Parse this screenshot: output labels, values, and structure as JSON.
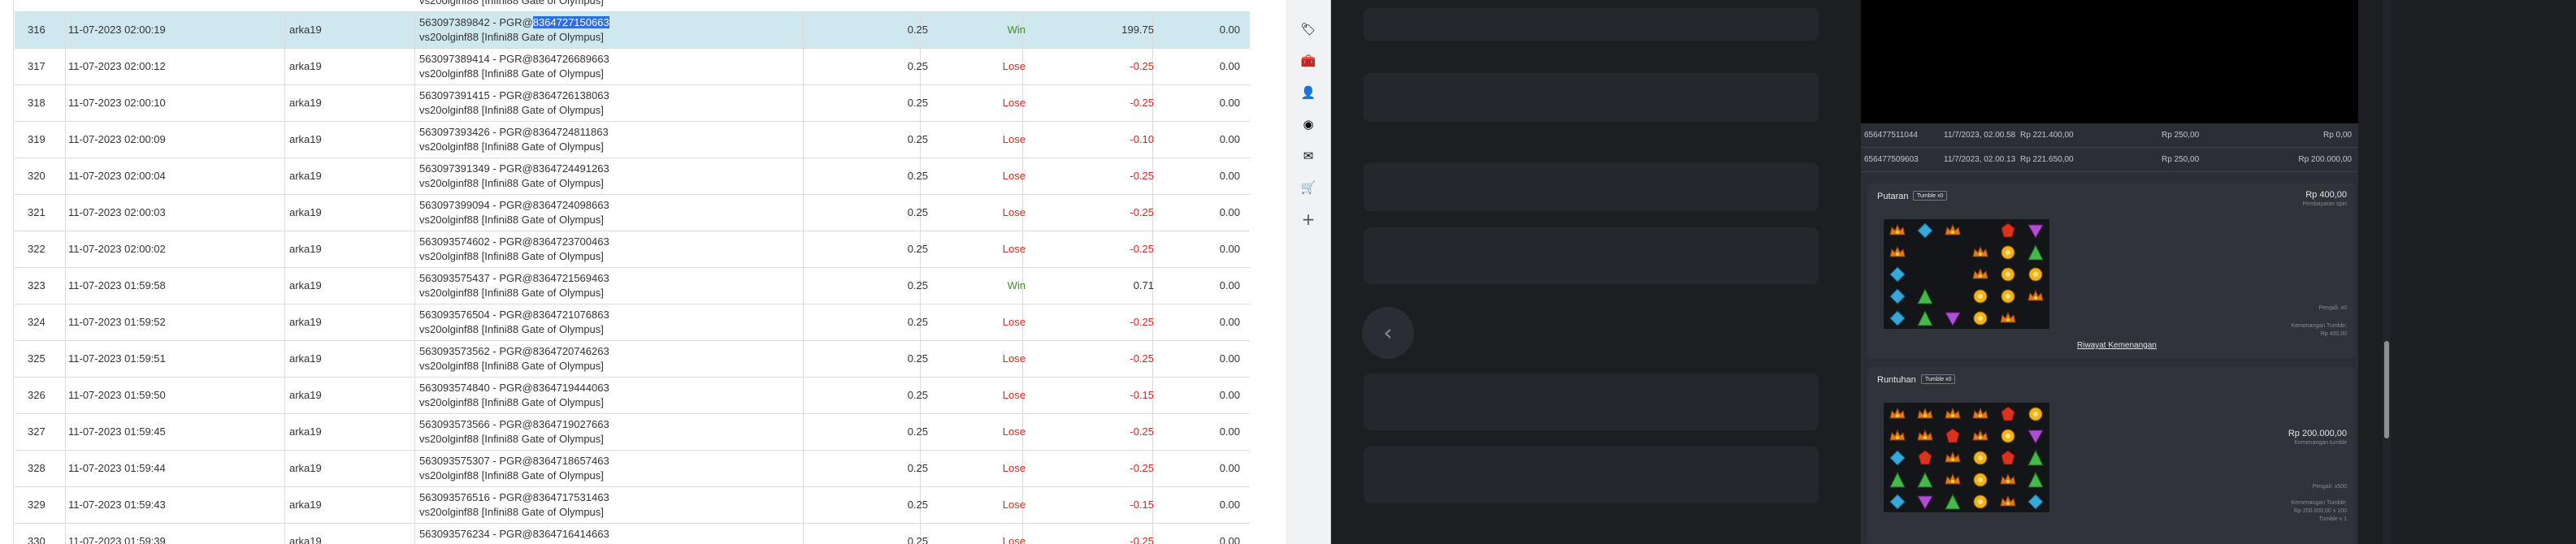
{
  "table": {
    "partial_top": {
      "line": "vs20olginf88 [Infini88 Gate of Olympus]"
    },
    "rows": [
      {
        "no": "316",
        "date": "11-07-2023 02:00:19",
        "user": "arka19",
        "ref": "563097389842 - PGR@",
        "ref_hl": "8364727150663",
        "game": "vs20olginf88 [Infini88 Gate of Olympus]",
        "bet": "0.25",
        "result": "Win",
        "win": "199.75",
        "last": "0.00"
      },
      {
        "no": "317",
        "date": "11-07-2023 02:00:12",
        "user": "arka19",
        "ref": "563097389414 - PGR@8364726689663",
        "ref_hl": "",
        "game": "vs20olginf88 [Infini88 Gate of Olympus]",
        "bet": "0.25",
        "result": "Lose",
        "win": "-0.25",
        "last": "0.00"
      },
      {
        "no": "318",
        "date": "11-07-2023 02:00:10",
        "user": "arka19",
        "ref": "563097391415 - PGR@8364726138063",
        "ref_hl": "",
        "game": "vs20olginf88 [Infini88 Gate of Olympus]",
        "bet": "0.25",
        "result": "Lose",
        "win": "-0.25",
        "last": "0.00"
      },
      {
        "no": "319",
        "date": "11-07-2023 02:00:09",
        "user": "arka19",
        "ref": "563097393426 - PGR@8364724811863",
        "ref_hl": "",
        "game": "vs20olginf88 [Infini88 Gate of Olympus]",
        "bet": "0.25",
        "result": "Lose",
        "win": "-0.10",
        "last": "0.00"
      },
      {
        "no": "320",
        "date": "11-07-2023 02:00:04",
        "user": "arka19",
        "ref": "563097391349 - PGR@8364724491263",
        "ref_hl": "",
        "game": "vs20olginf88 [Infini88 Gate of Olympus]",
        "bet": "0.25",
        "result": "Lose",
        "win": "-0.25",
        "last": "0.00"
      },
      {
        "no": "321",
        "date": "11-07-2023 02:00:03",
        "user": "arka19",
        "ref": "563097399094 - PGR@8364724098663",
        "ref_hl": "",
        "game": "vs20olginf88 [Infini88 Gate of Olympus]",
        "bet": "0.25",
        "result": "Lose",
        "win": "-0.25",
        "last": "0.00"
      },
      {
        "no": "322",
        "date": "11-07-2023 02:00:02",
        "user": "arka19",
        "ref": "563093574602 - PGR@8364723700463",
        "ref_hl": "",
        "game": "vs20olginf88 [Infini88 Gate of Olympus]",
        "bet": "0.25",
        "result": "Lose",
        "win": "-0.25",
        "last": "0.00"
      },
      {
        "no": "323",
        "date": "11-07-2023 01:59:58",
        "user": "arka19",
        "ref": "563093575437 - PGR@8364721569463",
        "ref_hl": "",
        "game": "vs20olginf88 [Infini88 Gate of Olympus]",
        "bet": "0.25",
        "result": "Win",
        "win": "0.71",
        "last": "0.00"
      },
      {
        "no": "324",
        "date": "11-07-2023 01:59:52",
        "user": "arka19",
        "ref": "563093576504 - PGR@8364721076863",
        "ref_hl": "",
        "game": "vs20olginf88 [Infini88 Gate of Olympus]",
        "bet": "0.25",
        "result": "Lose",
        "win": "-0.25",
        "last": "0.00"
      },
      {
        "no": "325",
        "date": "11-07-2023 01:59:51",
        "user": "arka19",
        "ref": "563093573562 - PGR@8364720746263",
        "ref_hl": "",
        "game": "vs20olginf88 [Infini88 Gate of Olympus]",
        "bet": "0.25",
        "result": "Lose",
        "win": "-0.25",
        "last": "0.00"
      },
      {
        "no": "326",
        "date": "11-07-2023 01:59:50",
        "user": "arka19",
        "ref": "563093574840 - PGR@8364719444063",
        "ref_hl": "",
        "game": "vs20olginf88 [Infini88 Gate of Olympus]",
        "bet": "0.25",
        "result": "Lose",
        "win": "-0.15",
        "last": "0.00"
      },
      {
        "no": "327",
        "date": "11-07-2023 01:59:45",
        "user": "arka19",
        "ref": "563093573566 - PGR@8364719027663",
        "ref_hl": "",
        "game": "vs20olginf88 [Infini88 Gate of Olympus]",
        "bet": "0.25",
        "result": "Lose",
        "win": "-0.25",
        "last": "0.00"
      },
      {
        "no": "328",
        "date": "11-07-2023 01:59:44",
        "user": "arka19",
        "ref": "563093575307 - PGR@8364718657463",
        "ref_hl": "",
        "game": "vs20olginf88 [Infini88 Gate of Olympus]",
        "bet": "0.25",
        "result": "Lose",
        "win": "-0.25",
        "last": "0.00"
      },
      {
        "no": "329",
        "date": "11-07-2023 01:59:43",
        "user": "arka19",
        "ref": "563093576516 - PGR@8364717531463",
        "ref_hl": "",
        "game": "vs20olginf88 [Infini88 Gate of Olympus]",
        "bet": "0.25",
        "result": "Lose",
        "win": "-0.15",
        "last": "0.00"
      },
      {
        "no": "330",
        "date": "11-07-2023 01:59:39",
        "user": "arka19",
        "ref": "563093576234 - PGR@8364716414663",
        "ref_hl": "",
        "game": "vs20olginf88 [Infini88 Gate of Olympus]",
        "bet": "0.25",
        "result": "Lose",
        "win": "-0.25",
        "last": "0.00"
      }
    ]
  },
  "sidebar": {
    "icons": [
      "tag-icon",
      "toolbox-icon",
      "person-icon",
      "circle-app-icon",
      "outlook-icon",
      "cart-icon",
      "add-icon"
    ],
    "glyphs": [
      "🏷",
      "🧰",
      "👤",
      "◉",
      "✉",
      "🛒",
      "+"
    ]
  },
  "history": {
    "rows": [
      {
        "id": "656477511044",
        "date": "11/7/2023, 02.00.58",
        "balance": "Rp 221.400,00",
        "bet": "Rp 250,00",
        "win": "Rp 0,00"
      },
      {
        "id": "656477509603",
        "date": "11/7/2023, 02.00.13",
        "balance": "Rp 221.650,00",
        "bet": "Rp 250,00",
        "win": "Rp 200.000,00"
      }
    ],
    "spin": {
      "title": "Putaran",
      "badge": "Tumble x0",
      "amount": "Rp 400,00",
      "amount_sub": "Pembayaran spin",
      "info": [
        "Pengali: x0",
        "Kemenangan Tumble:",
        "Rp 400,00"
      ],
      "link": "Riwayat Kemenangan"
    },
    "tumble": {
      "title": "Runtuhan",
      "badge": "Tumble x0",
      "amount": "Rp 200.000,00",
      "amount_sub": "Kemenangan tumble",
      "info": [
        "Pengali: x500",
        "Kemenangan Tumble:",
        "Rp 200.000,00 x 100",
        "Tumble x 1"
      ]
    }
  },
  "grids": {
    "spin": [
      [
        "crown",
        "blue",
        "crown",
        "",
        "red",
        "purple"
      ],
      [
        "crown",
        "",
        "",
        "crown",
        "yellow",
        "green"
      ],
      [
        "blue",
        "",
        "",
        "crown",
        "yellow",
        "yellow"
      ],
      [
        "blue",
        "green",
        "",
        "yellow",
        "yellow",
        "crown"
      ],
      [
        "blue",
        "green",
        "purple",
        "yellow",
        "crown",
        ""
      ]
    ],
    "tumble": [
      [
        "crown",
        "crown",
        "crown",
        "crown",
        "red",
        "yellow"
      ],
      [
        "crown",
        "crown",
        "red",
        "crown",
        "yellow",
        "purple"
      ],
      [
        "blue",
        "red",
        "crown",
        "yellow",
        "red",
        "green"
      ],
      [
        "green",
        "green",
        "crown",
        "yellow",
        "crown",
        "green"
      ],
      [
        "blue",
        "purple",
        "green",
        "yellow",
        "crown",
        "blue"
      ]
    ]
  },
  "colors": {
    "win": "#3a8f24",
    "lose": "#d9261c",
    "selected_row": "#cfe8f0",
    "highlight": "#2f6fdb"
  }
}
